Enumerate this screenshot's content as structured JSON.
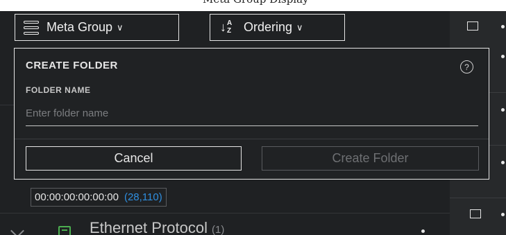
{
  "header": {
    "cut_text": "Meta Group Display"
  },
  "toolbar": {
    "meta_group_label": "Meta Group",
    "ordering_label": "Ordering",
    "chevron": "∨"
  },
  "dialog": {
    "title": "CREATE FOLDER",
    "help_icon": "?",
    "field_label": "FOLDER NAME",
    "input_placeholder": "Enter folder name",
    "input_value": "",
    "cancel_label": "Cancel",
    "create_label": "Create Folder"
  },
  "meta_value_chip": {
    "value": "00:00:00:00:00:00",
    "count": "(28,110)"
  },
  "meta_key_row": {
    "title": "Ethernet Protocol",
    "count": "(1)"
  },
  "colors": {
    "background": "#1f2123",
    "accent_count": "#2f8fe0",
    "network_icon": "#4caf50",
    "border_light": "#e6e6e6",
    "disabled_text": "#6e7073"
  },
  "icons": {
    "meta_group": "meta-group-icon",
    "ordering": "sort-az-icon",
    "help": "help-circle-icon",
    "network": "network-icon",
    "expand": "chevron-down-icon",
    "more": "kebab-menu-icon"
  }
}
